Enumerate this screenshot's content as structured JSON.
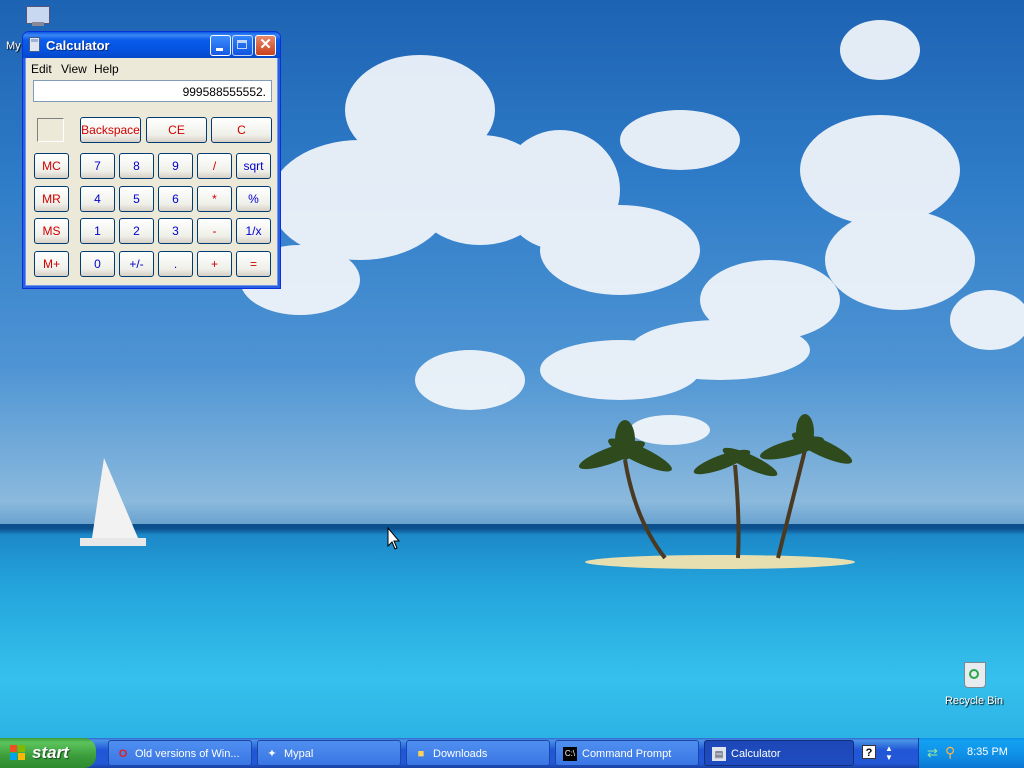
{
  "desktop": {
    "icons": {
      "my_computer": {
        "label": "My",
        "icon": "my-computer-icon"
      },
      "recycle_bin": {
        "label": "Recycle Bin",
        "icon": "recycle-bin-icon"
      }
    }
  },
  "calculator": {
    "title": "Calculator",
    "menu": [
      "Edit",
      "View",
      "Help"
    ],
    "display_value": "999588555552.",
    "buttons": {
      "backspace": "Backspace",
      "ce": "CE",
      "c": "C",
      "mc": "MC",
      "mr": "MR",
      "ms": "MS",
      "mplus": "M+",
      "seven": "7",
      "eight": "8",
      "nine": "9",
      "divide": "/",
      "sqrt": "sqrt",
      "four": "4",
      "five": "5",
      "six": "6",
      "multiply": "*",
      "percent": "%",
      "one": "1",
      "two": "2",
      "three": "3",
      "minus": "-",
      "reciprocal": "1/x",
      "zero": "0",
      "plusminus": "+/-",
      "decimal": ".",
      "plus": "+",
      "equals": "="
    }
  },
  "taskbar": {
    "start_label": "start",
    "tasks": [
      {
        "label": "Old versions of Win...",
        "icon": "opera-icon"
      },
      {
        "label": "Mypal",
        "icon": "mypal-icon"
      },
      {
        "label": "Downloads",
        "icon": "folder-icon"
      },
      {
        "label": "Command Prompt",
        "icon": "cmd-icon"
      },
      {
        "label": "Calculator",
        "icon": "calculator-icon"
      }
    ],
    "tray": {
      "clock": "8:35 PM"
    }
  },
  "colors": {
    "title_blue": "#0553e0",
    "start_green": "#3b9d3b",
    "red_key": "#d00000",
    "blue_key": "#0000d0"
  }
}
